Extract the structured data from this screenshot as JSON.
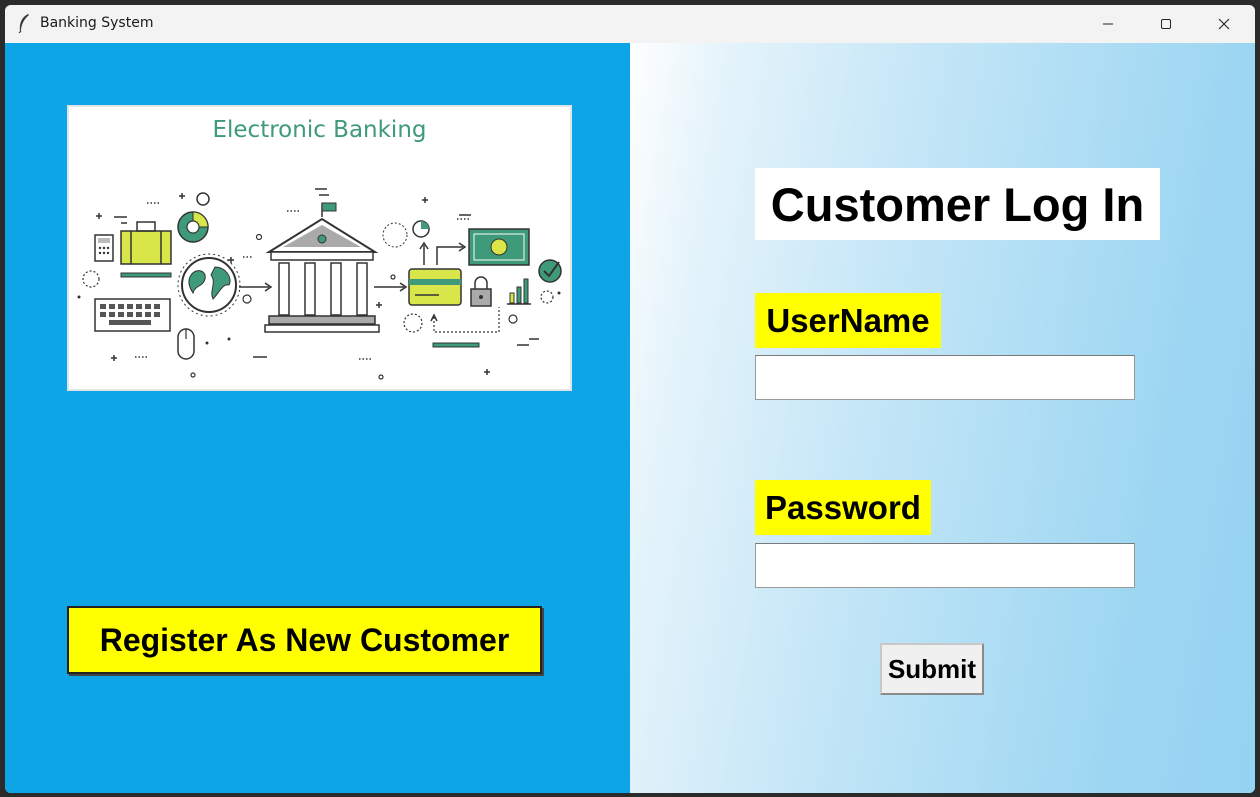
{
  "window": {
    "title": "Banking System"
  },
  "banner": {
    "title": "Electronic Banking",
    "icons": [
      "calculator-icon",
      "suitcase-icon",
      "globe-icon",
      "bank-icon",
      "credit-card-icon",
      "money-bill-icon",
      "lock-icon",
      "bar-chart-icon",
      "checkmark-icon",
      "keyboard-icon",
      "mouse-icon",
      "pie-chart-icon"
    ]
  },
  "register": {
    "label": "Register As New Customer"
  },
  "login": {
    "title": "Customer Log In",
    "username_label": "UserName",
    "username_value": "",
    "password_label": "Password",
    "password_value": "",
    "submit_label": "Submit"
  },
  "colors": {
    "left_panel": "#0ea5e6",
    "label_bg": "#ffff00",
    "banner_accent": "#3e9a78",
    "banner_yellow": "#d8e64a"
  }
}
